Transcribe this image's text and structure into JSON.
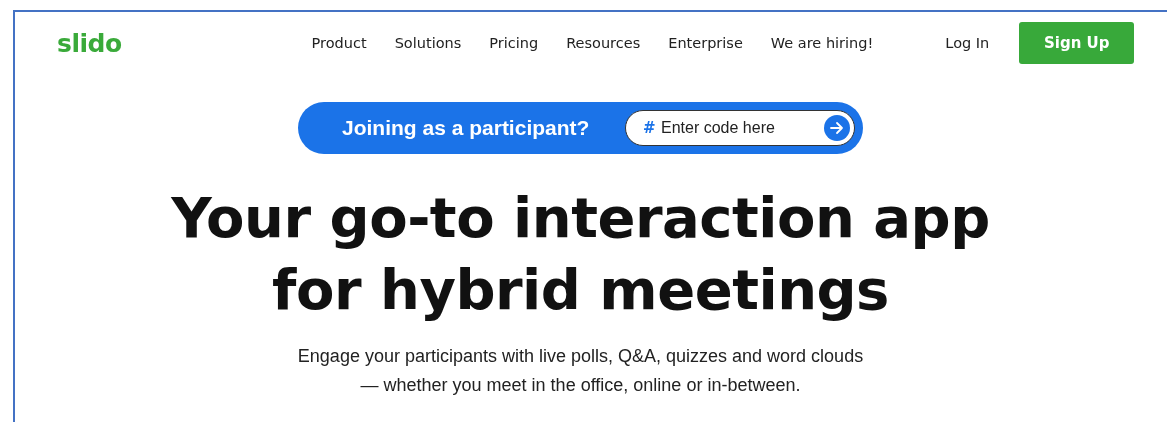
{
  "header": {
    "logo": "slido",
    "nav": [
      "Product",
      "Solutions",
      "Pricing",
      "Resources",
      "Enterprise",
      "We are hiring!"
    ],
    "login": "Log In",
    "signup": "Sign Up"
  },
  "join": {
    "label": "Joining as a participant?",
    "hash": "#",
    "placeholder": "Enter code here"
  },
  "hero": {
    "title_lines": [
      "Your go-to interaction app",
      "for hybrid meetings"
    ],
    "subtitle_lines": [
      "Engage your participants with live polls, Q&A, quizzes and word clouds",
      "— whether you meet in the office, online or in-between."
    ]
  }
}
